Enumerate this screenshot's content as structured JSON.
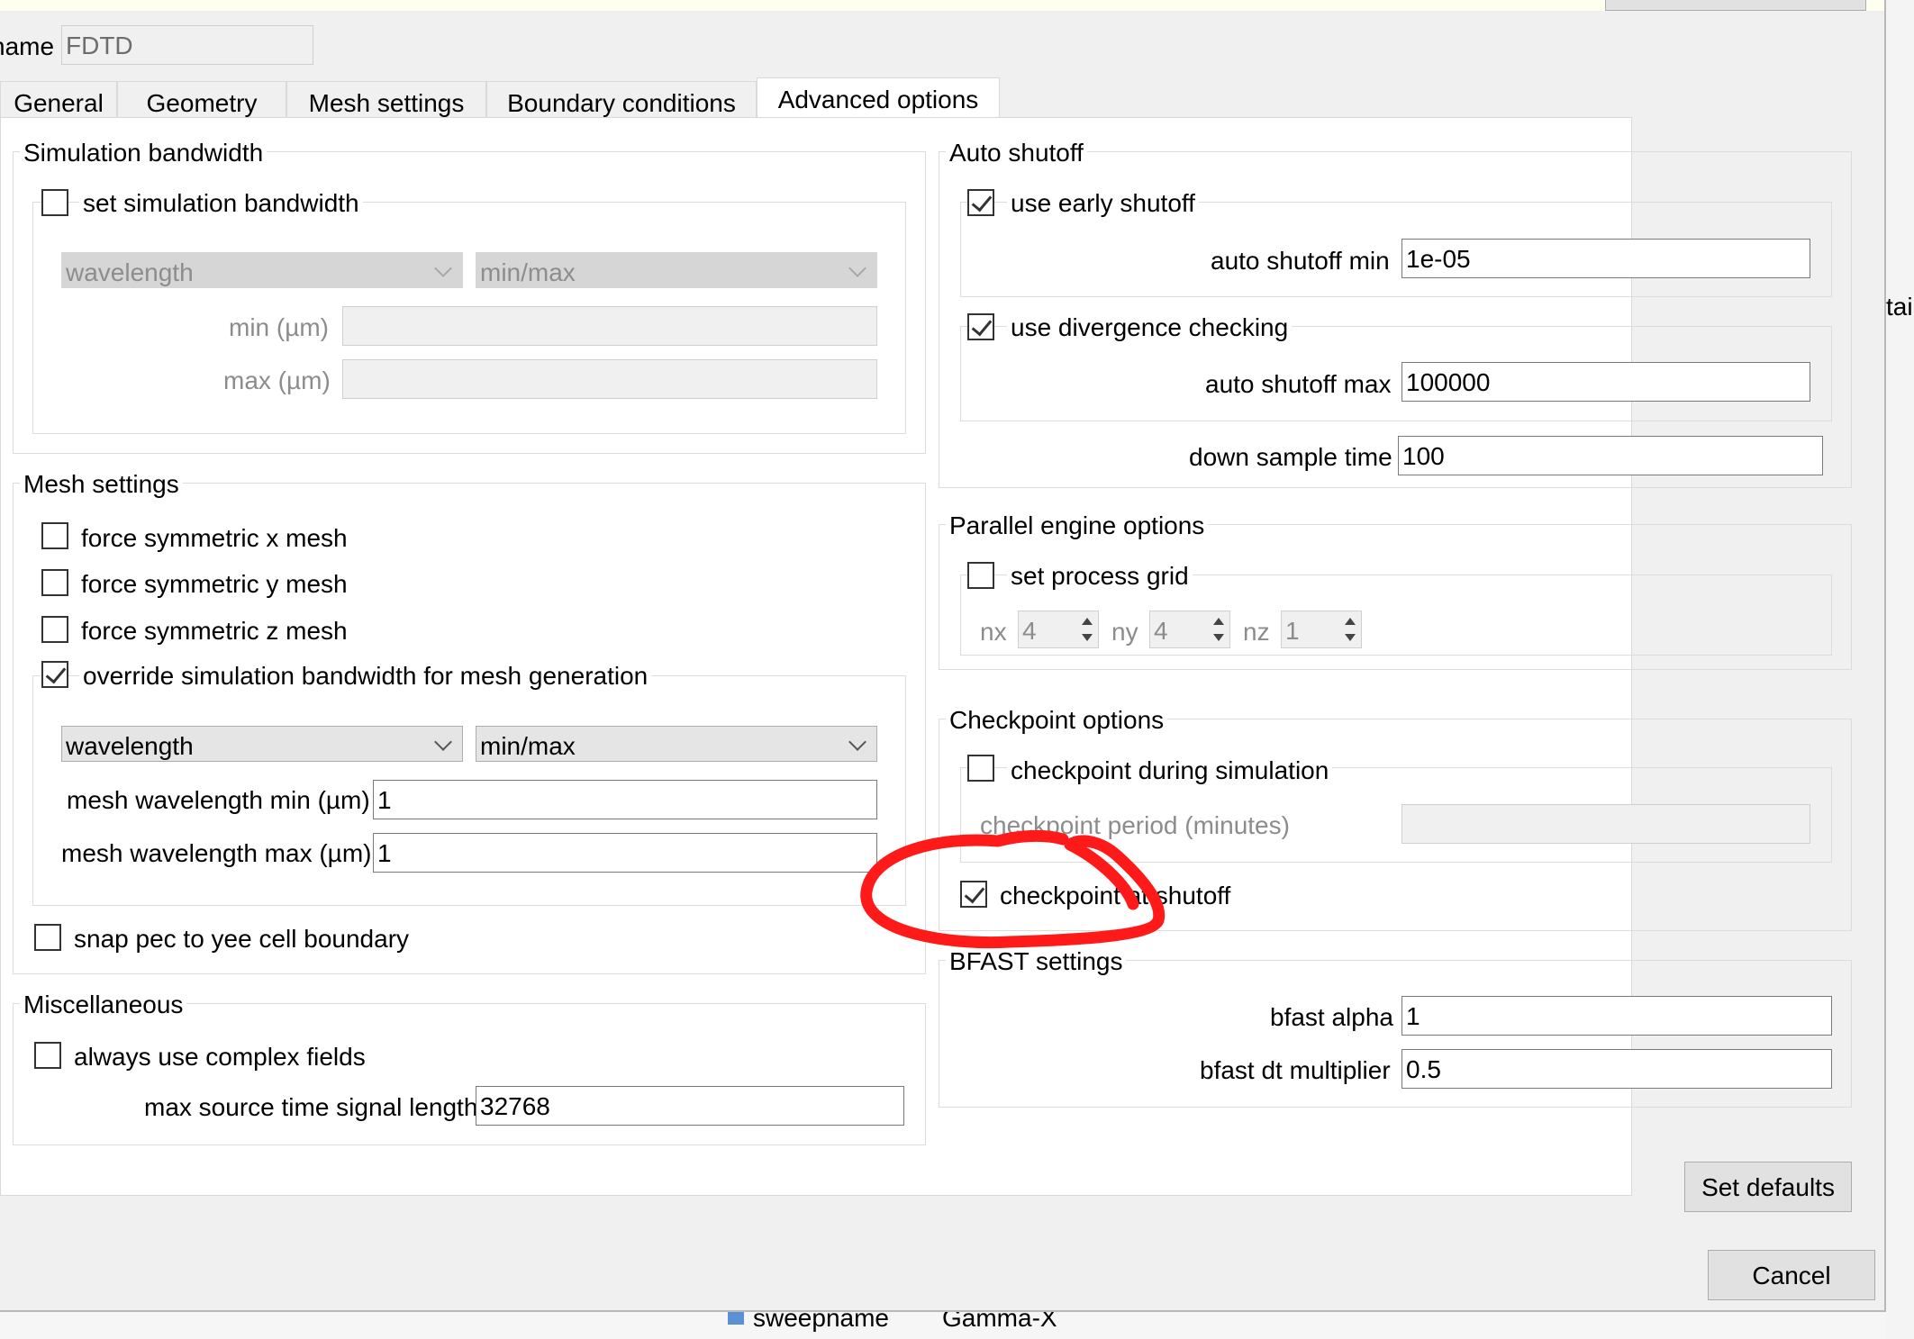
{
  "window": {
    "name_label": "name",
    "name_value": "FDTD"
  },
  "tabs": [
    "General",
    "Geometry",
    "Mesh settings",
    "Boundary conditions",
    "Advanced options"
  ],
  "simulation_bandwidth": {
    "title": "Simulation bandwidth",
    "set_bandwidth_label": "set simulation bandwidth",
    "set_bandwidth_checked": false,
    "type_combo": "wavelength",
    "range_combo": "min/max",
    "min_label": "min (µm)",
    "max_label": "max (µm)",
    "min_value": "",
    "max_value": ""
  },
  "mesh_settings": {
    "title": "Mesh settings",
    "sym_x_label": "force symmetric x mesh",
    "sym_y_label": "force symmetric y mesh",
    "sym_z_label": "force symmetric z mesh",
    "override_label": "override simulation bandwidth for mesh generation",
    "override_checked": true,
    "type_combo": "wavelength",
    "range_combo": "min/max",
    "wl_min_label": "mesh wavelength min (µm)",
    "wl_min_value": "1",
    "wl_max_label": "mesh wavelength max (µm)",
    "wl_max_value": "1",
    "snap_label": "snap pec to yee cell boundary"
  },
  "miscellaneous": {
    "title": "Miscellaneous",
    "complex_label": "always use complex fields",
    "max_source_label": "max source time signal length",
    "max_source_value": "32768"
  },
  "auto_shutoff": {
    "title": "Auto shutoff",
    "early_label": "use early shutoff",
    "early_checked": true,
    "min_label": "auto shutoff min",
    "min_value": "1e-05",
    "divergence_label": "use divergence checking",
    "divergence_checked": true,
    "max_label": "auto shutoff max",
    "max_value": "100000",
    "down_sample_label": "down sample time",
    "down_sample_value": "100"
  },
  "parallel": {
    "title": "Parallel engine options",
    "process_grid_label": "set process grid",
    "nx_label": "nx",
    "nx_value": "4",
    "ny_label": "ny",
    "ny_value": "4",
    "nz_label": "nz",
    "nz_value": "1"
  },
  "checkpoint": {
    "title": "Checkpoint options",
    "during_label": "checkpoint during simulation",
    "period_label": "checkpoint period (minutes)",
    "at_shutoff_label": "checkpoint at shutoff",
    "at_shutoff_checked": true
  },
  "bfast": {
    "title": "BFAST settings",
    "alpha_label": "bfast alpha",
    "alpha_value": "1",
    "dt_label": "bfast dt multiplier",
    "dt_value": "0.5"
  },
  "buttons": {
    "set_defaults": "Set defaults",
    "cancel": "Cancel"
  },
  "background": {
    "sweep_name": "sweepname",
    "sweep_value": "Gamma-X",
    "side_fragment": "tai"
  },
  "colors": {
    "annotation_red": "#ff1a1a"
  }
}
